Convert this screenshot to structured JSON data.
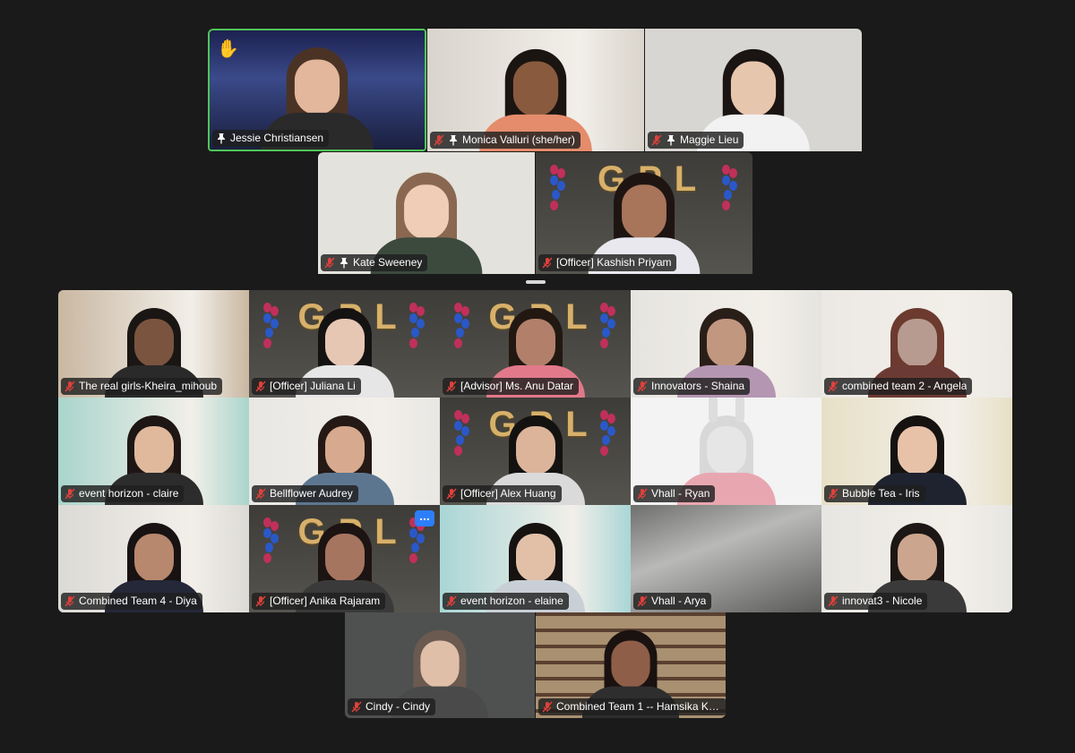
{
  "meeting": {
    "view": "gallery",
    "active_speaker": "Jessie Christiansen",
    "raised_hand": "Jessie Christiansen"
  },
  "participants": [
    {
      "name": "Jessie Christiansen",
      "muted": false,
      "pinned": true,
      "hand_raised": true,
      "scene": "spaceship",
      "bg": "#262b55",
      "hair": "#4a3325",
      "skin": "#e3b79c",
      "shirt": "#2a2a2a"
    },
    {
      "name": "Monica Valluri (she/her)",
      "muted": true,
      "pinned": true,
      "scene": "room",
      "bg": "#d9d4cc",
      "hair": "#1b1512",
      "skin": "#8a5a3e",
      "shirt": "#e48c6c"
    },
    {
      "name": "Maggie Lieu",
      "muted": true,
      "pinned": true,
      "scene": "plain",
      "bg": "#d8d6d2",
      "hair": "#1a1412",
      "skin": "#e7c6ae",
      "shirt": "#f2f2f2"
    },
    {
      "name": "Kate Sweeney",
      "muted": true,
      "pinned": true,
      "scene": "plain",
      "bg": "#e4e2dc",
      "hair": "#8a6750",
      "skin": "#efcdb6",
      "shirt": "#3b4a3c"
    },
    {
      "name": "[Officer] Kashish Priyam",
      "muted": true,
      "pinned": false,
      "scene": "gpl",
      "bg": "#4a4844",
      "hair": "#1e1512",
      "skin": "#a8755a",
      "shirt": "#e8e8ee"
    },
    {
      "name": "The real girls-Kheira_mihoub",
      "muted": true,
      "pinned": false,
      "scene": "room",
      "bg": "#c9b7a1",
      "hair": "#1a1614",
      "skin": "#7b5440",
      "shirt": "#2a2a2a"
    },
    {
      "name": "[Officer] Juliana Li",
      "muted": true,
      "pinned": false,
      "scene": "gpl",
      "bg": "#4a4844",
      "hair": "#151212",
      "skin": "#e6c7b4",
      "shirt": "#e6e6e6"
    },
    {
      "name": "[Advisor] Ms. Anu Datar",
      "muted": true,
      "pinned": false,
      "scene": "gpl",
      "bg": "#4a4844",
      "hair": "#221812",
      "skin": "#b2806a",
      "shirt": "#e2798a"
    },
    {
      "name": "Innovators - Shaina",
      "muted": true,
      "pinned": false,
      "scene": "room",
      "bg": "#e6e4e0",
      "hair": "#2a1e18",
      "skin": "#c29780",
      "shirt": "#b496b2"
    },
    {
      "name": "combined team 2 - Angela",
      "muted": true,
      "pinned": false,
      "scene": "room",
      "bg": "#ece8e4",
      "hair": "#6c3a2e",
      "skin": "#b79a90",
      "shirt": "#6c3a34"
    },
    {
      "name": "event horizon - claire",
      "muted": true,
      "pinned": false,
      "scene": "room",
      "bg": "#a9d5cc",
      "hair": "#1e1614",
      "skin": "#e0b89c",
      "shirt": "#2c2c2c"
    },
    {
      "name": "Bellflower Audrey",
      "muted": true,
      "pinned": false,
      "scene": "room",
      "bg": "#e9e7e4",
      "hair": "#241914",
      "skin": "#d7a98e",
      "shirt": "#5d7690"
    },
    {
      "name": "[Officer] Alex Huang",
      "muted": true,
      "pinned": false,
      "scene": "gpl",
      "bg": "#4a4844",
      "hair": "#141210",
      "skin": "#dcb49a",
      "shirt": "#dadada"
    },
    {
      "name": "Vhall - Ryan",
      "muted": true,
      "pinned": false,
      "scene": "bunny",
      "bg": "#f3f3f3",
      "hair": "#d8d8d8",
      "skin": "#e6e6e6",
      "shirt": "#e8a7b0"
    },
    {
      "name": "Bubble Tea - Iris",
      "muted": true,
      "pinned": false,
      "scene": "room",
      "bg": "#e7e0c6",
      "hair": "#151210",
      "skin": "#e7c2a8",
      "shirt": "#1f2330"
    },
    {
      "name": "Combined Team 4 - Diya",
      "muted": true,
      "pinned": false,
      "scene": "room",
      "bg": "#dcdad6",
      "hair": "#181212",
      "skin": "#b7876e",
      "shirt": "#242838"
    },
    {
      "name": "[Officer] Anika Rajaram",
      "muted": true,
      "pinned": false,
      "scene": "gpl",
      "bg": "#4a4844",
      "hair": "#1c1412",
      "skin": "#a67560",
      "shirt": "#3a3a3a",
      "more_button": "..."
    },
    {
      "name": "event horizon - elaine",
      "muted": true,
      "pinned": false,
      "scene": "room",
      "bg": "#a9d6d6",
      "hair": "#151210",
      "skin": "#e2c0a8",
      "shirt": "#c9cfd6"
    },
    {
      "name": "Vhall - Arya",
      "muted": true,
      "pinned": false,
      "scene": "blur",
      "bg": "#8f8f8d",
      "hair": "",
      "skin": "",
      "shirt": ""
    },
    {
      "name": "innovat3 - Nicole",
      "muted": true,
      "pinned": false,
      "scene": "room",
      "bg": "#e8e6e2",
      "hair": "#1c1614",
      "skin": "#cca58e",
      "shirt": "#3a3a3a"
    },
    {
      "name": "Cindy - Cindy",
      "muted": true,
      "pinned": false,
      "scene": "plain",
      "bg": "#4f5151",
      "hair": "#6a5a50",
      "skin": "#e0bfa8",
      "shirt": "#4a4a4a"
    },
    {
      "name": "Combined Team 1 -- Hamsika Ku...",
      "muted": true,
      "pinned": false,
      "scene": "bookshelf",
      "bg": "#6a4e38",
      "hair": "#1a1210",
      "skin": "#8e5e48",
      "shirt": "#2e2e2e"
    }
  ],
  "colors": {
    "background": "#1a1a1a",
    "active_speaker_border": "#4fc558",
    "muted_icon": "#e0403a",
    "more_button": "#2d7ff9"
  }
}
